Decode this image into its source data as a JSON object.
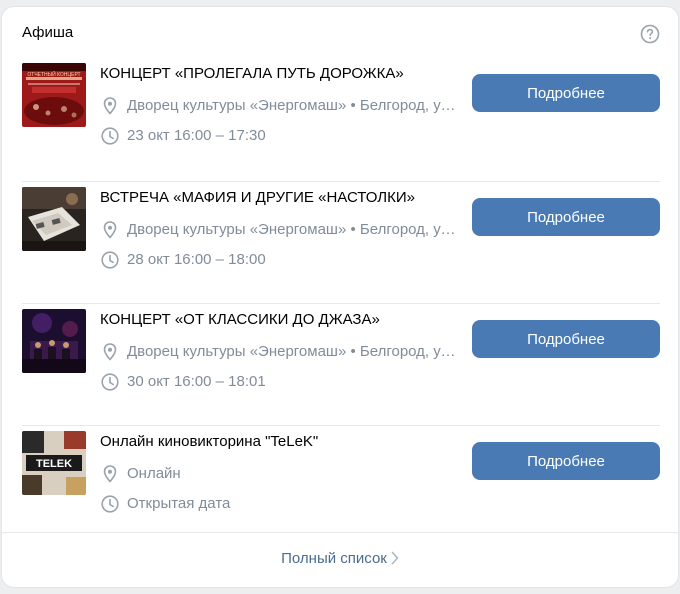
{
  "widget": {
    "title": "Афиша",
    "help_icon": "question-circle-icon"
  },
  "events": [
    {
      "title": "КОНЦЕРТ «ПРОЛЕГАЛА ПУТЬ ДОРОЖКА»",
      "location": "Дворец культуры «Энергомаш» • Белгород, ул. Мичурина",
      "datetime": "23 окт 16:00 – 17:30",
      "button_label": "Подробнее",
      "thumb_caption": "ОТЧЕТНЫЙ КОНЦЕРТ"
    },
    {
      "title": "ВСТРЕЧА «МАФИЯ И ДРУГИЕ «НАСТОЛКИ»",
      "location": "Дворец культуры «Энергомаш» • Белгород, ул. Мичурина",
      "datetime": "28 окт 16:00 – 18:00",
      "button_label": "Подробнее"
    },
    {
      "title": "КОНЦЕРТ «ОТ КЛАССИКИ ДО ДЖАЗА»",
      "location": "Дворец культуры «Энергомаш» • Белгород, ул. Мичурина",
      "datetime": "30 окт 16:00 – 18:01",
      "button_label": "Подробнее"
    },
    {
      "title": "Онлайн киновикторина \"TeLeK\"",
      "location": "Онлайн",
      "datetime": "Открытая дата",
      "button_label": "Подробнее",
      "thumb_caption": "TELEK"
    }
  ],
  "footer": {
    "full_list_label": "Полный список"
  },
  "colors": {
    "button": "#4a7ab4",
    "meta_text": "#818c99",
    "link": "#4c6c8f"
  }
}
